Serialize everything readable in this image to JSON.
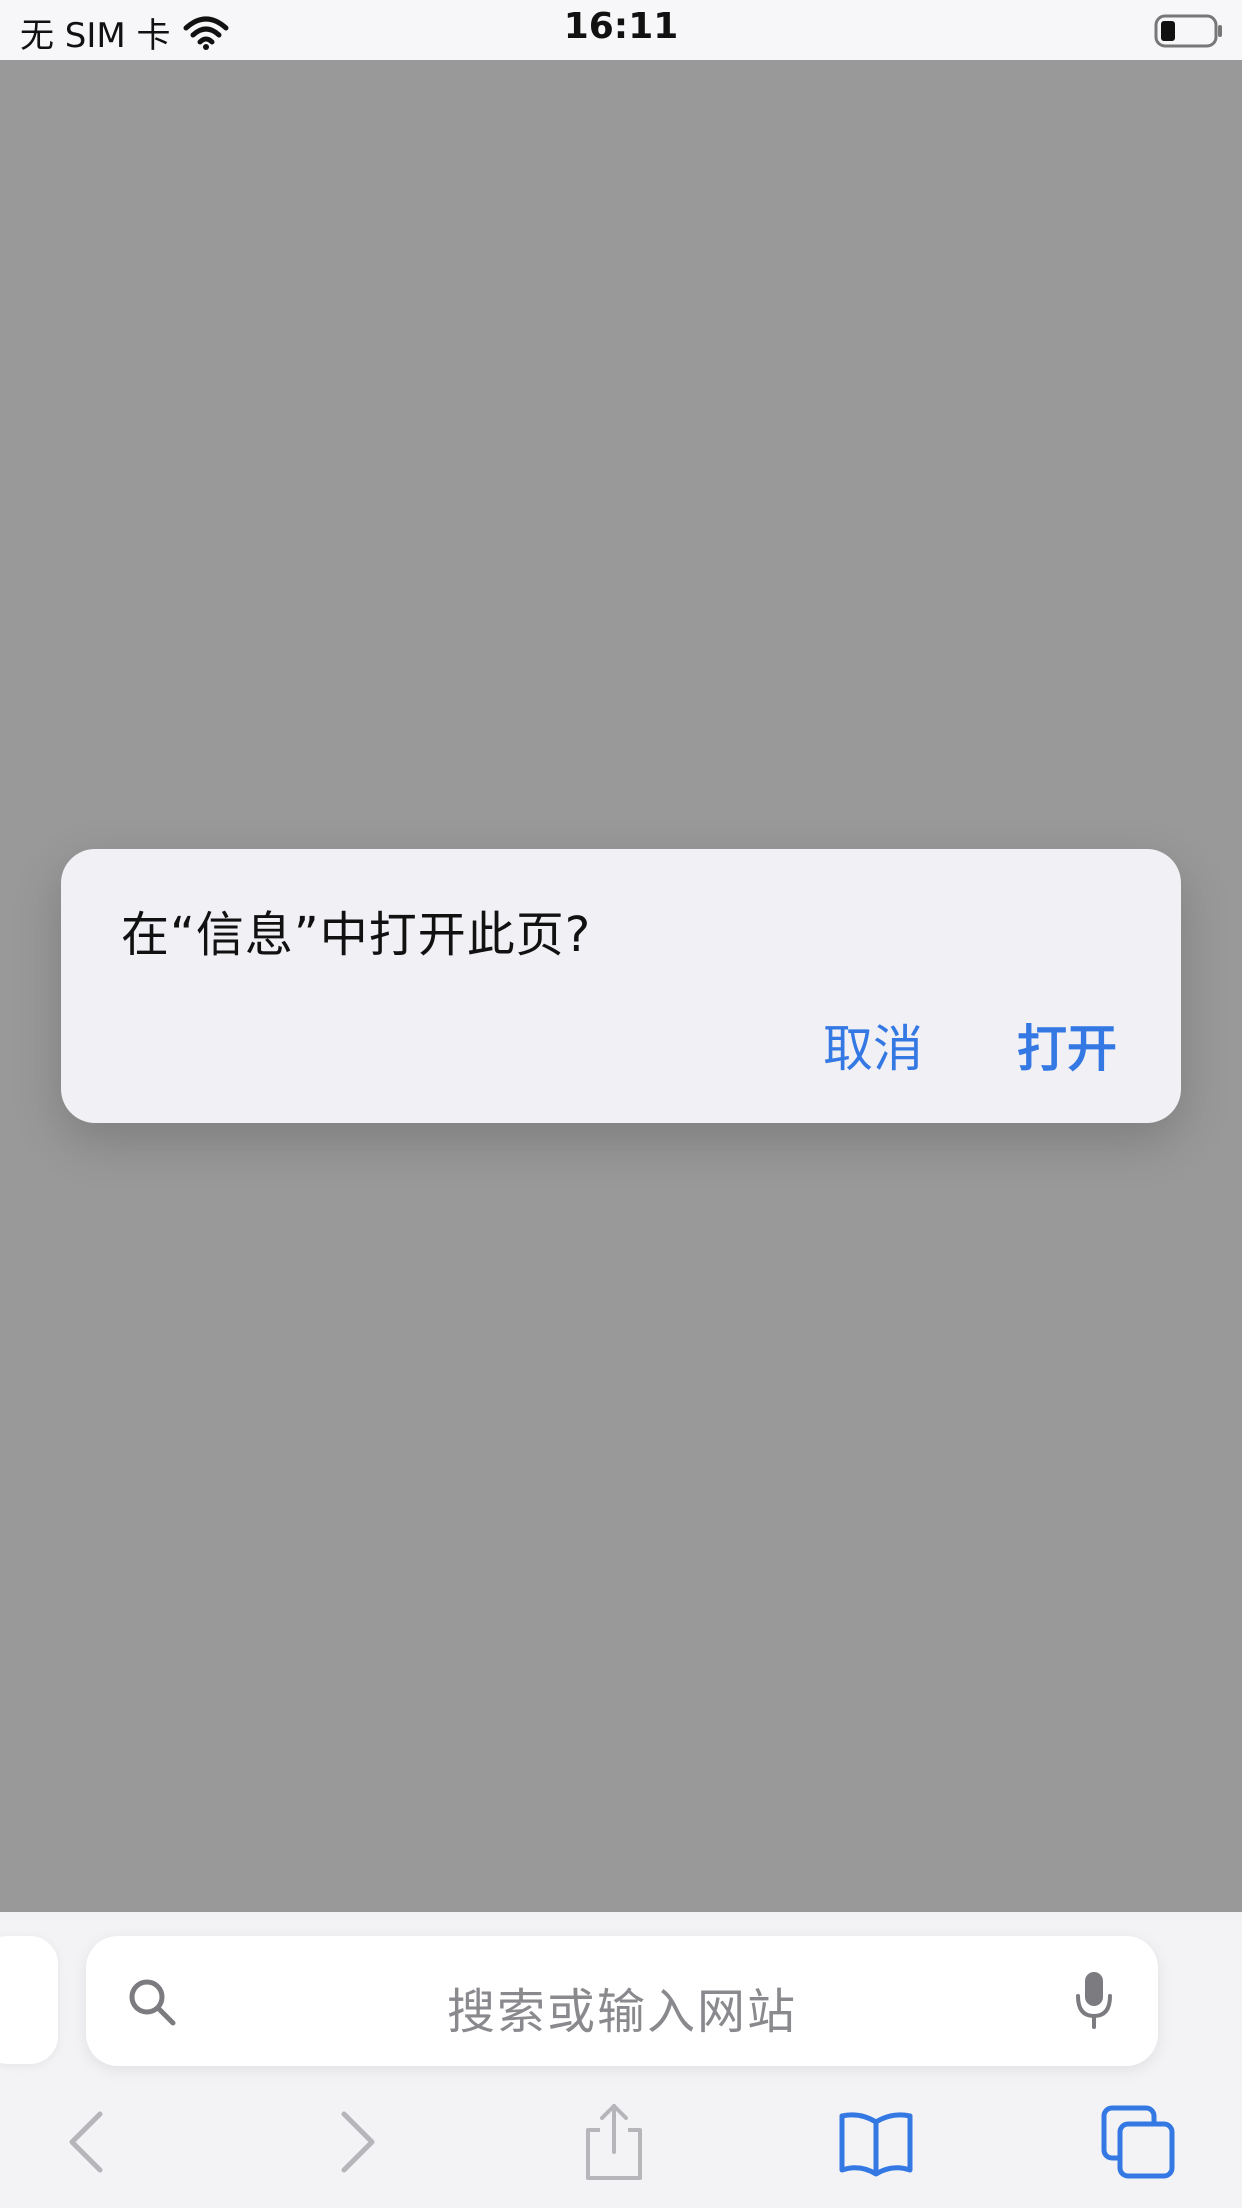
{
  "status_bar": {
    "carrier": "无 SIM 卡",
    "time": "16:11",
    "wifi_icon": "wifi-icon",
    "battery_icon": "battery-icon"
  },
  "dialog": {
    "message": "在“信息”中打开此页?",
    "cancel_label": "取消",
    "open_label": "打开"
  },
  "browser": {
    "search_placeholder": "搜索或输入网站",
    "icons": {
      "search": "search-icon",
      "microphone": "microphone-icon",
      "back": "back-chevron-icon",
      "forward": "forward-chevron-icon",
      "share": "share-icon",
      "bookmarks": "book-icon",
      "tabs": "tabs-icon"
    }
  },
  "colors": {
    "accent": "#3478e4",
    "overlay": "#999999",
    "dialog_bg": "#f0f0f5",
    "disabled_icon": "#b5b5ba"
  }
}
